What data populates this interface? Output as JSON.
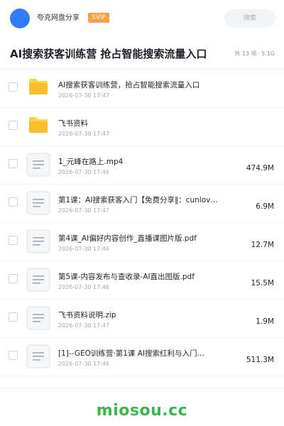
{
  "header": {
    "user_name": "夸克网盘分享",
    "vip_badge": "SVIP",
    "search_placeholder": "搜索"
  },
  "share": {
    "title": "AI搜索获客训练营 抢占智能搜索流量入口",
    "count": "共 13 项",
    "separator": "·",
    "total_size": "5.1G"
  },
  "files": [
    {
      "type": "folder",
      "name": "AI搜索获客训练营，抢占智能搜索流量入口",
      "date": "2026-07-30 17:47",
      "size": ""
    },
    {
      "type": "folder",
      "name": "飞书资料",
      "date": "2026-07-30 17:47",
      "size": ""
    },
    {
      "type": "file",
      "name": "1_元峰在路上.mp4",
      "date": "2026-07-30 17:46",
      "size": "474.9M"
    },
    {
      "type": "file",
      "name": "第1课：AI搜索获客入门【免费分享‖：cunlov…",
      "date": "2026-07-30 17:47",
      "size": "6.9M"
    },
    {
      "type": "file",
      "name": "第4课_AI偏好内容创作_直播课图片版.pdf",
      "date": "2026-07-30 17:46",
      "size": "12.7M"
    },
    {
      "type": "file",
      "name": "第5课-内容发布与查收录-AI直出图版.pdf",
      "date": "2026-07-30 17:46",
      "size": "15.5M"
    },
    {
      "type": "file",
      "name": "飞书资料说明.zip",
      "date": "2026-07-30 17:47",
      "size": "1.9M"
    },
    {
      "type": "file",
      "name": "[1]--GEO训练营·第1课 AI搜索红利与入门…",
      "date": "2026-07-30 17:46",
      "size": "511.3M"
    }
  ],
  "watermark": "miosou.cc",
  "colors": {
    "accent": "#2f7cf6",
    "vip": "#f7a043",
    "folder": "#fbd148",
    "watermark": "#39b54a"
  }
}
